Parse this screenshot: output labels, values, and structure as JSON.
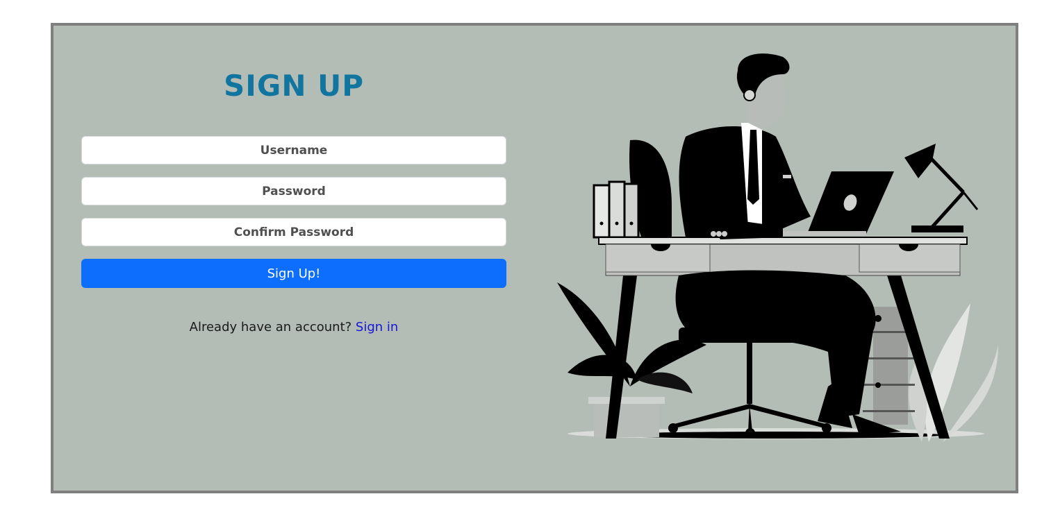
{
  "form": {
    "title": "SIGN UP",
    "username_placeholder": "Username",
    "password_placeholder": "Password",
    "confirm_placeholder": "Confirm Password",
    "submit_label": "Sign Up!",
    "signin_prompt": "Already have an account? ",
    "signin_link": "Sign in"
  },
  "colors": {
    "panel_bg": "#b3bdb6",
    "frame_border": "#7f7f7f",
    "title": "#12759f",
    "submit_bg": "#0d6efd",
    "link": "#1616d8"
  },
  "illustration": {
    "icon": "businessman-at-desk-illustration"
  }
}
